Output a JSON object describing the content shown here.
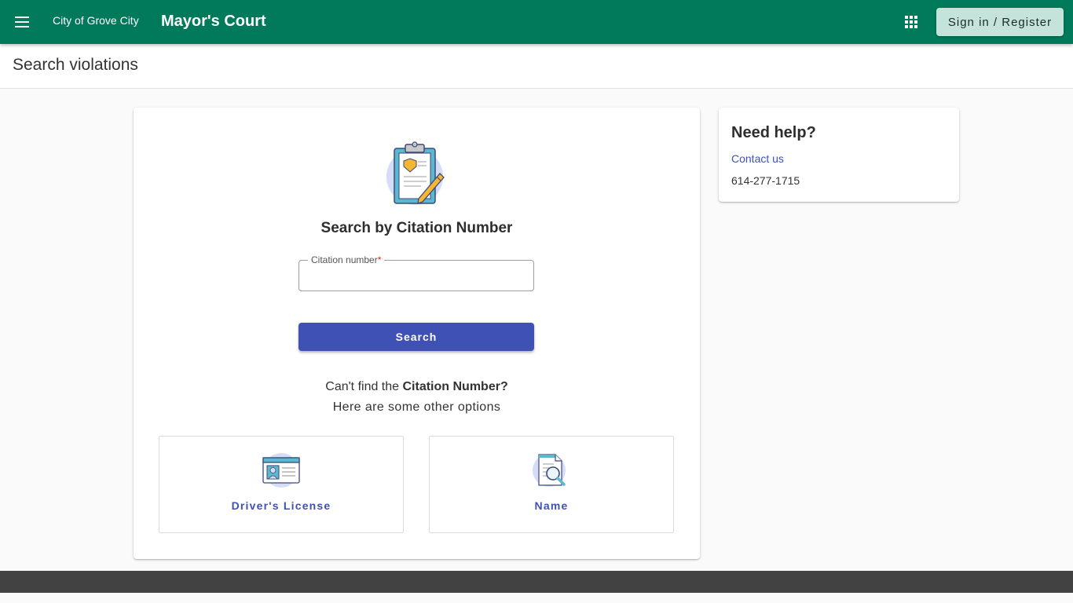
{
  "topbar": {
    "menu_icon": "hamburger-menu-icon",
    "org_name": "City of Grove City",
    "app_title": "Mayor's Court",
    "apps_icon": "apps-grid-icon",
    "signin_label": "Sign in / Register",
    "color": "#007a5a"
  },
  "page": {
    "title": "Search violations"
  },
  "search": {
    "illustration": "clipboard-pencil-icon",
    "heading": "Search by Citation Number",
    "field_label": "Citation number",
    "required_mark": "*",
    "field_value": "",
    "button_label": "Search",
    "accent_color": "#3f51b5"
  },
  "alternatives": {
    "prompt_prefix": "Can't find the ",
    "prompt_bold": "Citation Number?",
    "subtitle": "Here are some other options",
    "options": [
      {
        "label": "Driver's License",
        "icon": "id-card-icon"
      },
      {
        "label": "Name",
        "icon": "document-search-icon"
      }
    ]
  },
  "help": {
    "title": "Need help?",
    "contact_label": "Contact us",
    "phone": "614-277-1715"
  }
}
